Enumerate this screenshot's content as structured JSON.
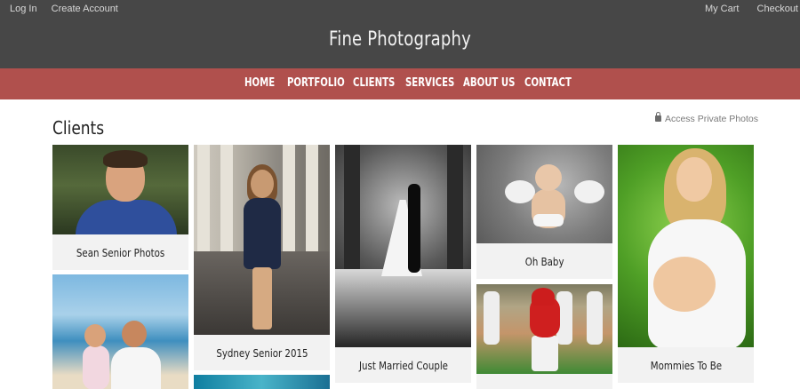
{
  "top_links": {
    "left": [
      "Log In",
      "Create Account"
    ],
    "right": [
      "My Cart",
      "Checkout"
    ]
  },
  "site_title": "Fine Photography",
  "nav": [
    "HOME",
    "PORTFOLIO",
    "CLIENTS",
    "SERVICES",
    "ABOUT US",
    "CONTACT"
  ],
  "page_title": "Clients",
  "private_link": "Access Private Photos",
  "galleries": [
    {
      "title": "Sean Senior Photos"
    },
    {
      "title": "Sydney Senior 2015"
    },
    {
      "title": "Just Married Couple"
    },
    {
      "title": "Oh Baby"
    },
    {
      "title": "Mommies To Be"
    }
  ],
  "colors": {
    "header_bg": "#474747",
    "nav_bg": "#b0504d",
    "card_bg": "#f2f2f2"
  }
}
